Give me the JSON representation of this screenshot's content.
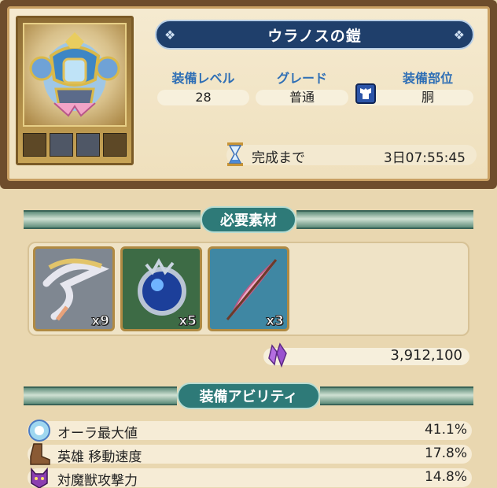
{
  "equipment": {
    "title": "ウラノスの鎧",
    "stats": [
      {
        "label": "装備レベル",
        "value": "28"
      },
      {
        "label": "グレード",
        "value": "普通"
      },
      {
        "label": "装備部位",
        "value": "胴"
      }
    ],
    "completion_label": "完成まで",
    "completion_time": "3日07:55:45"
  },
  "materials": {
    "header": "必要素材",
    "items": [
      {
        "icon": "feather-horn-icon",
        "count": "x9"
      },
      {
        "icon": "blue-orb-icon",
        "count": "x5"
      },
      {
        "icon": "pink-feather-icon",
        "count": "x3"
      }
    ],
    "cost": "3,912,100",
    "cost_icon": "purple-crystal-icon"
  },
  "abilities": {
    "header": "装備アビリティ",
    "items": [
      {
        "icon": "aura-icon",
        "name": "オーラ最大値",
        "value": "41.1%"
      },
      {
        "icon": "boot-icon",
        "name": "英雄 移動速度",
        "value": "17.8%"
      },
      {
        "icon": "demon-icon",
        "name": "対魔獣攻撃力",
        "value": "14.8%"
      }
    ]
  },
  "colors": {
    "accent_blue": "#2f6fb5",
    "banner_navy": "#1f3f6b",
    "section_teal": "#2e7a78",
    "panel_brown": "#6e4d2c"
  }
}
